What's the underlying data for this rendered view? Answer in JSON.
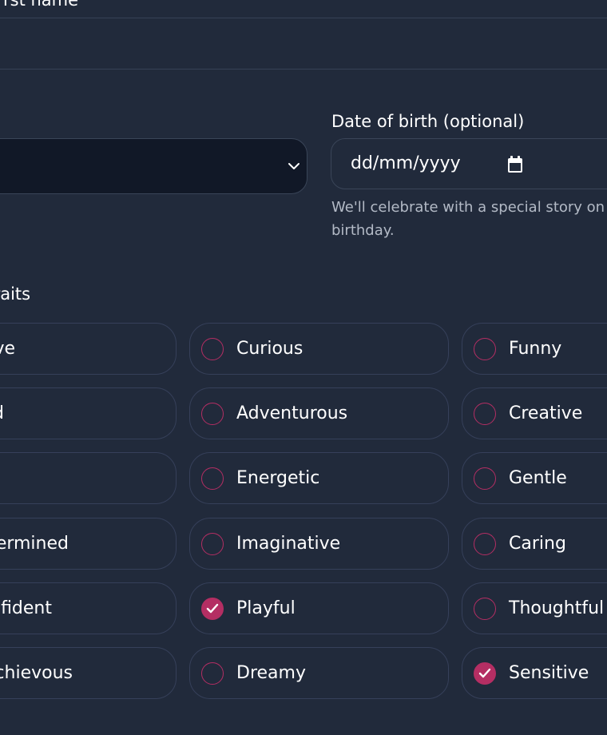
{
  "form": {
    "first_name_label": "rst name",
    "dob": {
      "label": "Date of birth (optional)",
      "placeholder": "dd/mm/yyyy",
      "help_line1": "We'll celebrate with a special story on their",
      "help_line2": "birthday."
    },
    "traits_label": "ty traits",
    "traits": {
      "col_a": [
        {
          "label": "ve",
          "checked": false
        },
        {
          "label": "d",
          "checked": false
        },
        {
          "label": "",
          "checked": false
        },
        {
          "label": "ermined",
          "checked": false
        },
        {
          "label": "fident",
          "checked": false
        },
        {
          "label": "chievous",
          "checked": false
        }
      ],
      "col_b": [
        {
          "label": "Curious",
          "checked": false
        },
        {
          "label": "Adventurous",
          "checked": false
        },
        {
          "label": "Energetic",
          "checked": false
        },
        {
          "label": "Imaginative",
          "checked": false
        },
        {
          "label": "Playful",
          "checked": true
        },
        {
          "label": "Dreamy",
          "checked": false
        }
      ],
      "col_c": [
        {
          "label": "Funny",
          "checked": false
        },
        {
          "label": "Creative",
          "checked": false
        },
        {
          "label": "Gentle",
          "checked": false
        },
        {
          "label": "Caring",
          "checked": false
        },
        {
          "label": "Thoughtful",
          "checked": false
        },
        {
          "label": "Sensitive",
          "checked": true
        }
      ]
    }
  },
  "colors": {
    "background": "#212a3b",
    "accent": "#b42e63",
    "border": "#36405a",
    "select_bg": "#111827"
  },
  "icons": {
    "select": "chevron-down-icon",
    "date": "calendar-icon",
    "check": "check-icon"
  }
}
